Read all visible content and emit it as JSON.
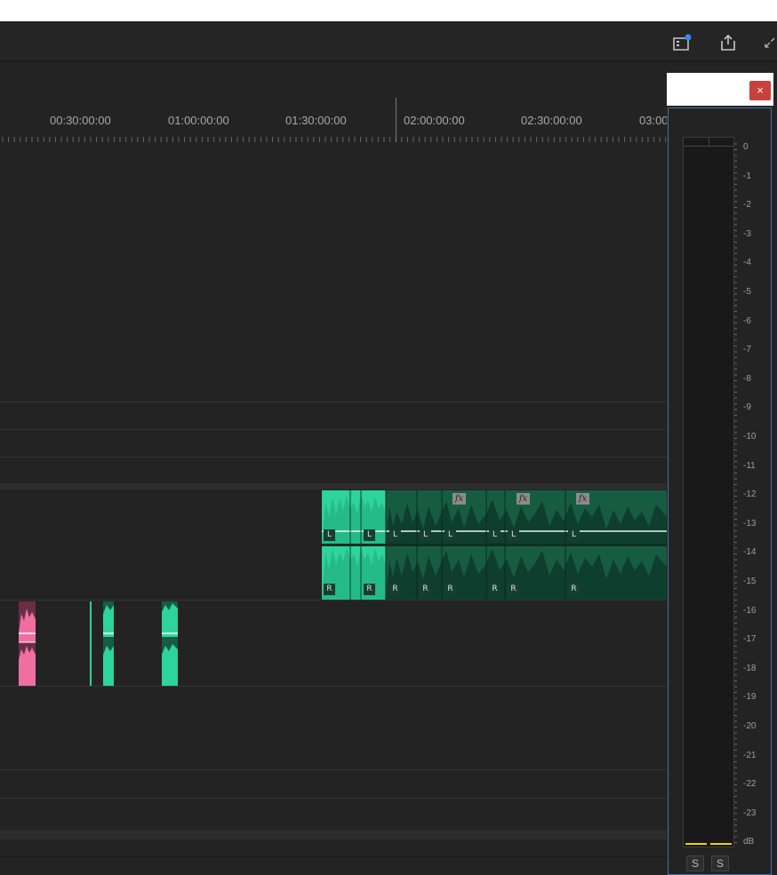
{
  "header": {
    "icons": [
      "panel-notification-icon",
      "share-icon",
      "expand-icon"
    ]
  },
  "ruler": {
    "timecodes": [
      "00:30:00:00",
      "01:00:00:00",
      "01:30:00:00",
      "02:00:00:00",
      "02:30:00:00",
      "03:00"
    ]
  },
  "tracks": {
    "audio_main": {
      "left_label": "L",
      "right_label": "R",
      "fx_label": "fx"
    }
  },
  "meter": {
    "close_label": "×",
    "db_scale": [
      "0",
      "-1",
      "-2",
      "-3",
      "-4",
      "-5",
      "-6",
      "-7",
      "-8",
      "-9",
      "-10",
      "-11",
      "-12",
      "-13",
      "-14",
      "-15",
      "-16",
      "-17",
      "-18",
      "-19",
      "-20",
      "-21",
      "-22",
      "-23",
      "dB"
    ],
    "solo_labels": [
      "S",
      "S"
    ]
  },
  "colors": {
    "clip_bright": "#2dd49b",
    "clip_dark": "#165c43",
    "clip_pink": "#ef6fa3",
    "meter_border": "#4a6fa5",
    "close_red": "#c9403d"
  }
}
